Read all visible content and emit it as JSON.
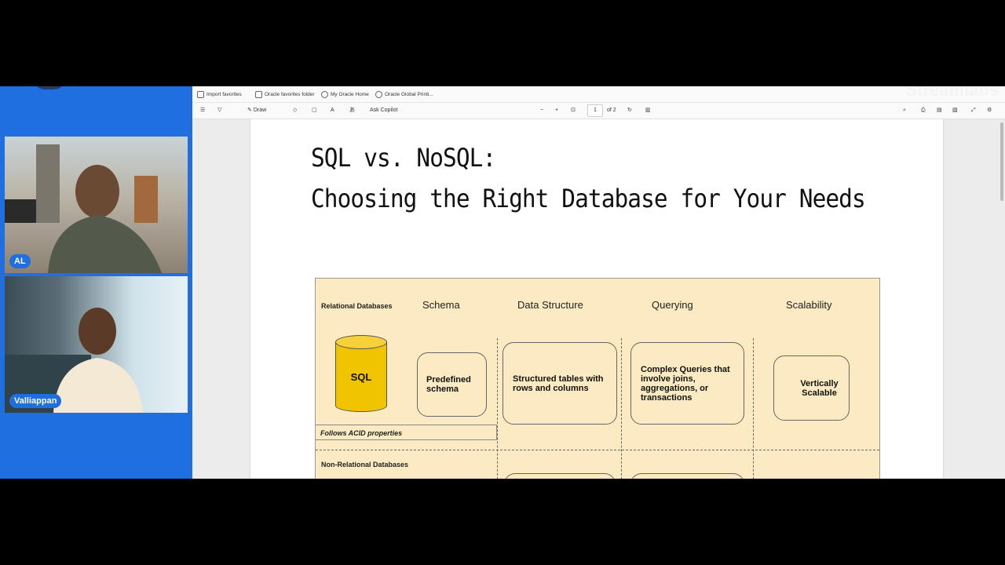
{
  "participants": [
    {
      "name": "AL"
    },
    {
      "name": "Valliappan"
    }
  ],
  "favorites": [
    "Import favorites",
    "Oracle favorites folder",
    "My Oracle Home",
    "Oracle Global Printi..."
  ],
  "toolbar": {
    "draw": "Draw",
    "ask_copilot": "Ask Copilot",
    "minus": "−",
    "plus": "+",
    "page": "1",
    "of": "of 2"
  },
  "watermark": "Streamlabs",
  "document": {
    "title_line1": "SQL vs. NoSQL:",
    "title_line2": "Choosing the Right Database for Your Needs",
    "row1_label": "Relational Databases",
    "row2_label": "Non-Relational Databases",
    "headers": [
      "Schema",
      "Data Structure",
      "Querying",
      "Scalability"
    ],
    "db_icon": "SQL",
    "acid": "Follows ACID properties",
    "schema": "Predefined schema",
    "structure": "Structured tables with rows and columns",
    "querying": "Complex Queries that involve joins, aggregations, or transactions",
    "scalability": "Vertically Scalable"
  },
  "colors": {
    "accent": "#1f6fe0",
    "diagram_bg": "#fbeac2",
    "cylinder": "#f0c400"
  }
}
